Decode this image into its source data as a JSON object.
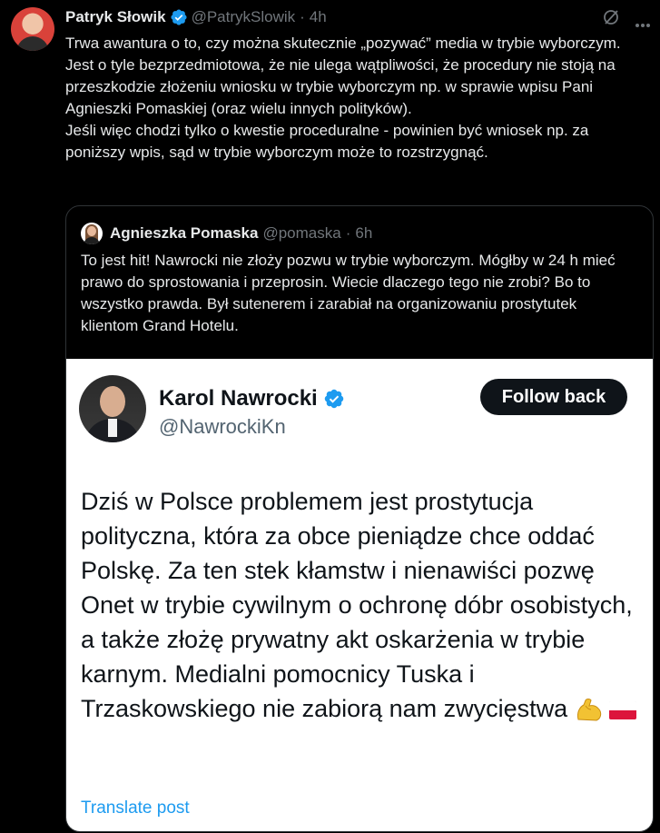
{
  "tweet": {
    "author_name": "Patryk Słowik",
    "handle": "@PatrykSlowik",
    "separator": "·",
    "time": "4h",
    "text": "Trwa awantura o to, czy można skutecznie „pozywać” media w trybie wyborczym.\nJest o tyle bezprzedmiotowa, że nie ulega wątpliwości, że procedury nie stoją na przeszkodzie złożeniu wniosku w trybie wyborczym np. w sprawie wpisu Pani Agnieszki Pomaskiej (oraz wielu innych polityków).\nJeśli więc chodzi tylko o kwestie proceduralne - powinien być wniosek np. za poniższy wpis, sąd w trybie wyborczym może to rozstrzygnąć."
  },
  "quoted": {
    "author_name": "Agnieszka Pomaska",
    "handle": "@pomaska",
    "separator": "·",
    "time": "6h",
    "text": "To jest hit! Nawrocki nie złoży pozwu w trybie wyborczym. Mógłby w 24 h mieć prawo do sprostowania i przeprosin. Wiecie dlaczego tego nie zrobi? Bo to wszystko prawda. Był sutenerem i zarabiał na organizowaniu prostytutek klientom Grand Hotelu."
  },
  "embedded": {
    "author_name": "Karol Nawrocki",
    "handle": "@NawrockiKn",
    "follow_label": "Follow back",
    "text": "Dziś w Polsce problemem jest prostytucja polityczna, która za obce pieniądze chce oddać Polskę. Za ten stek kłamstw i nienawiści pozwę Onet w trybie cywilnym o ochronę dóbr osobistych, a także złożę prywatny akt oskarżenia w trybie karnym. Medialni pomocnicy Tuska i Trzaskowskiego nie zabiorą nam zwycięstwa",
    "emojis": [
      "flexed-biceps",
      "flag-poland"
    ],
    "translate_label": "Translate post"
  },
  "icons": {
    "verified": "verified-badge-icon",
    "grok": "grok-icon",
    "more": "more-icon"
  },
  "colors": {
    "background": "#000000",
    "text": "#e7e9ea",
    "muted": "#71767b",
    "accent": "#1d9bf0",
    "border": "#2f3336"
  }
}
